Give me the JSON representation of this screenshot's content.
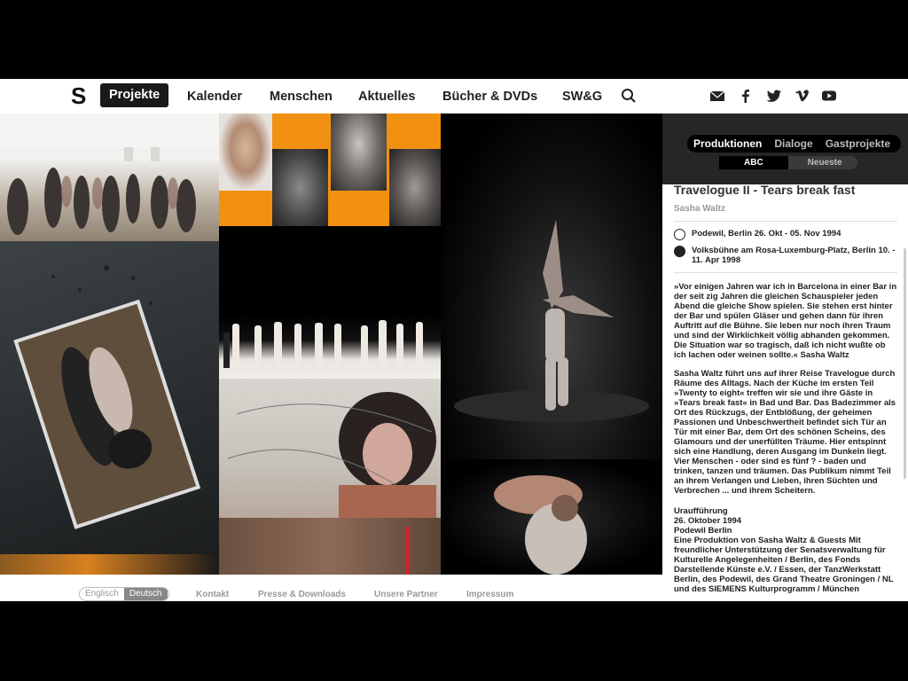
{
  "nav": {
    "logo": "S",
    "items": [
      "Projekte",
      "Kalender",
      "Menschen",
      "Aktuelles",
      "Bücher & DVDs",
      "SW&G"
    ],
    "icons": [
      "search-icon",
      "mail-icon",
      "facebook-icon",
      "twitter-icon",
      "vimeo-icon",
      "youtube-icon"
    ]
  },
  "panel": {
    "tabs": [
      "Produktionen",
      "Dialoge",
      "Gastprojekte"
    ],
    "sort": [
      "ABC",
      "Neueste"
    ],
    "title": "Travelogue II - Tears break fast",
    "author": "Sasha Waltz",
    "venues": [
      "Podewil, Berlin 26. Okt - 05. Nov 1994",
      "Volksbühne am Rosa-Luxemburg-Platz, Berlin 10. - 11. Apr 1998"
    ],
    "quote": "»Vor einigen Jahren war ich in Barcelona in einer Bar in der seit zig Jahren die gleichen Schauspieler jeden Abend die gleiche Show spielen. Sie stehen erst hinter der Bar und spülen Gläser und gehen dann für ihren Auftritt auf die Bühne. Sie leben nur noch ihren Traum und sind der Wirklichkeit völlig abhanden gekommen. Die Situation war so tragisch, daß ich nicht wußte ob ich lachen oder weinen sollte.« Sasha Waltz",
    "description": "Sasha Waltz führt uns auf ihrer Reise Travelogue durch Räume des Alltags. Nach der Küche im ersten Teil »Twenty to eight« treffen wir sie und ihre Gäste in »Tears break fast« in Bad und Bar. Das Badezimmer als Ort des Rückzugs, der Entblößung, der geheimen Passionen und Unbeschwertheit befindet sich Tür an Tür mit einer Bar, dem Ort des schönen Scheins, des Glamours und der unerfüllten Träume. Hier entspinnt sich eine Handlung, deren Ausgang im Dunkeln liegt. Vier Menschen - oder sind es fünf ? - baden und trinken, tanzen und träumen. Das Publikum nimmt Teil an ihrem Verlangen und Lieben, ihren Süchten und Verbrechen ... und ihrem Scheitern.",
    "premiere_label": "Uraufführung",
    "premiere_date": "26. Oktober 1994",
    "premiere_place": "Podewil Berlin",
    "credits": "Eine Produktion von Sasha Waltz & Guests Mit freundlicher Unterstützung der Senatsverwaltung für Kulturelle Angelegenheiten / Berlin, des Fonds Darstellende Künste e.V. / Essen, der TanzWerkstatt Berlin, des Podewil, des Grand Theatre Groningen / NL und des SIEMENS Kulturprogramm / München"
  },
  "footer": {
    "languages": [
      "Englisch",
      "Deutsch"
    ],
    "links": [
      "Kontakt",
      "Presse & Downloads",
      "Unsere Partner",
      "Impressum"
    ]
  },
  "colors": {
    "accent": "#f29111",
    "dark": "#1a1a1a"
  }
}
